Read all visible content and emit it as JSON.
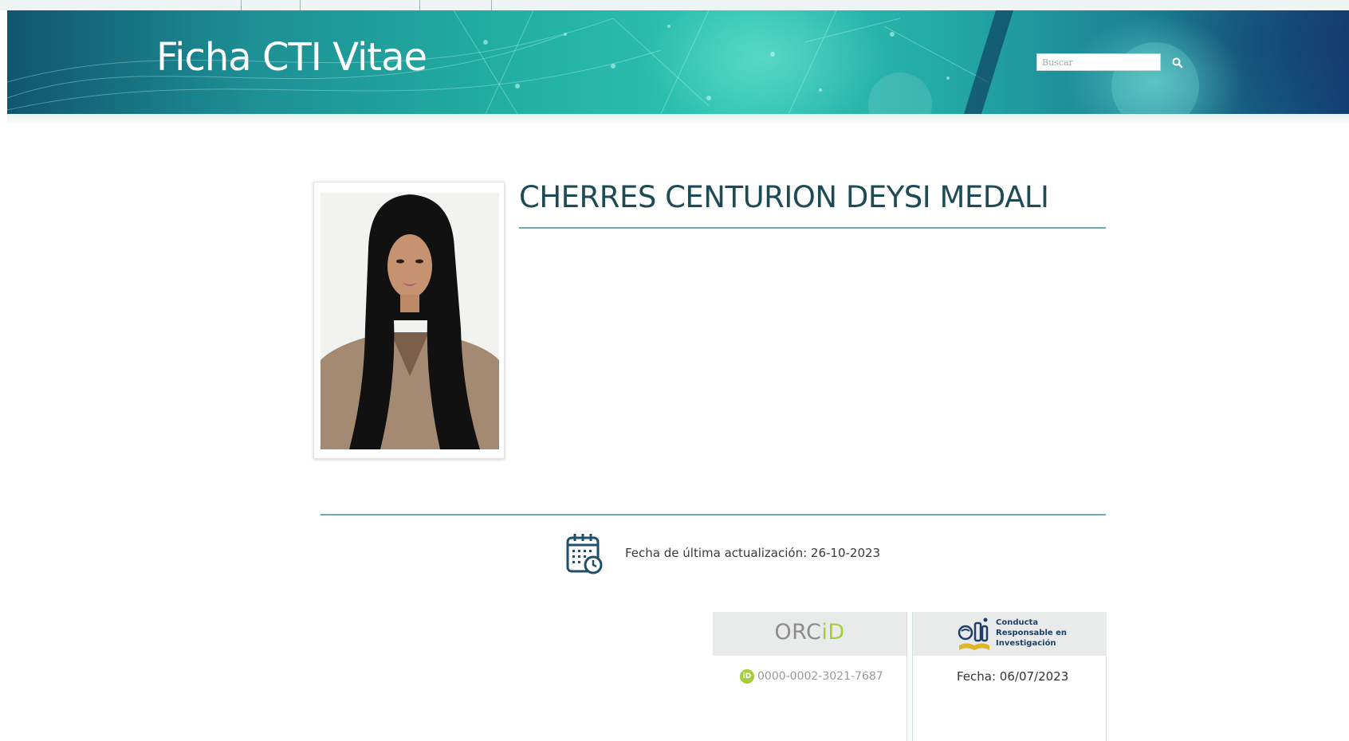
{
  "header": {
    "site_title": "Ficha CTI Vitae",
    "search": {
      "placeholder": "Buscar"
    },
    "search_icon": "search-icon"
  },
  "profile": {
    "name": "CHERRES CENTURION DEYSI MEDALI",
    "photo_alt": "profile-photo"
  },
  "update": {
    "icon": "calendar-clock-icon",
    "text": "Fecha de última actualización: 26-10-2023"
  },
  "orcid": {
    "logo_prefix": "ORC",
    "logo_suffix": "iD",
    "badge": "iD",
    "id": "0000-0002-3021-7687",
    "accent_color": "#a6ce39"
  },
  "conduct": {
    "line1": "Conducta",
    "line2": "Responsable en",
    "line3": "Investigación",
    "date_text": "Fecha:  06/07/2023"
  },
  "colors": {
    "banner_primary": "#22b0a2",
    "title_text": "#1c4a55",
    "rule": "#6fa9b1"
  }
}
